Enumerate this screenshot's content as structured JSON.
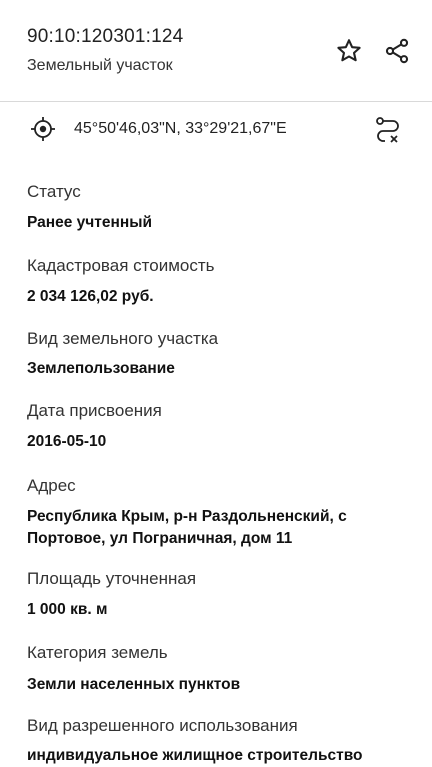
{
  "header": {
    "cadastral_number": "90:10:120301:124",
    "subtitle": "Земельный участок"
  },
  "location": {
    "coordinates": "45°50'46,03\"N, 33°29'21,67\"E"
  },
  "fields": [
    {
      "label": "Статус",
      "value": "Ранее учтенный"
    },
    {
      "label": "Кадастровая стоимость",
      "value": "2 034 126,02 руб."
    },
    {
      "label": "Вид земельного участка",
      "value": "Землепользование"
    },
    {
      "label": "Дата присвоения",
      "value": "2016-05-10"
    },
    {
      "label": "Адрес",
      "value": "Республика Крым, р-н Раздольненский, с Портовое, ул Пограничная, дом 11"
    },
    {
      "label": "Площадь уточненная",
      "value": "1 000 кв. м"
    },
    {
      "label": "Категория земель",
      "value": "Земли населенных пунктов"
    },
    {
      "label": "Вид разрешенного использования",
      "value": "индивидуальное жилищное строительство"
    }
  ],
  "icons": {
    "favorite": "star-icon",
    "share": "share-icon",
    "locate": "target-icon",
    "route": "route-icon"
  }
}
